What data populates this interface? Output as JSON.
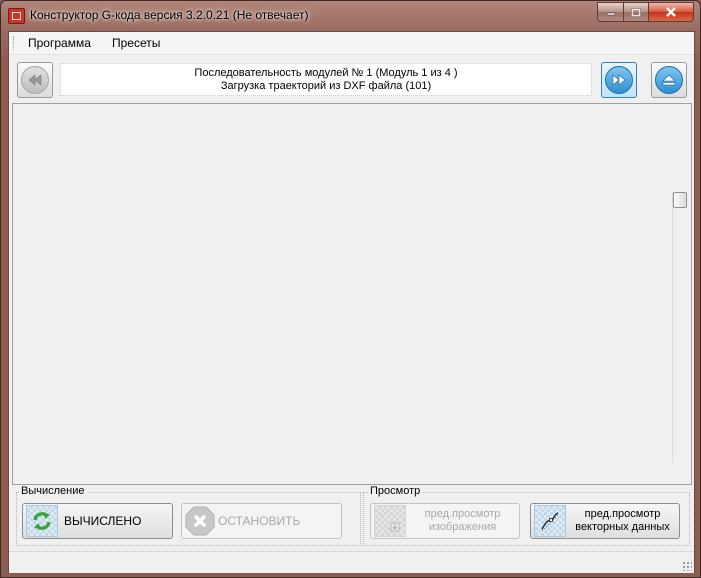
{
  "window": {
    "title": "Конструктор G-кода версия 3.2.0.21 (Не отвечает)",
    "controls": [
      "minimize-icon",
      "maximize-icon",
      "close-icon"
    ]
  },
  "menu": {
    "items": [
      {
        "label": "Программа"
      },
      {
        "label": "Пресеты"
      }
    ]
  },
  "navigator": {
    "sequence_line": "Последовательность модулей № 1 (Модуль 1 из 4 )",
    "module_line": "Загрузка траекторий из DXF файла (101)",
    "prev_icon": "rewind-icon",
    "next_icon": "fast-forward-icon",
    "eject_icon": "eject-icon"
  },
  "calculation": {
    "group_label": "Вычисление",
    "calculated_label": "ВЫЧИСЛЕНО",
    "stop_label": "ОСТАНОВИТЬ"
  },
  "preview": {
    "group_label": "Просмотр",
    "image_preview_label": "пред.просмотр\nизображения",
    "vector_preview_label": "пред.просмотр\nвекторных данных"
  },
  "colors": {
    "accent_blue": "#3c7fb1",
    "refresh_green": "#3aa23a",
    "title_bar": "#9a6b60"
  }
}
